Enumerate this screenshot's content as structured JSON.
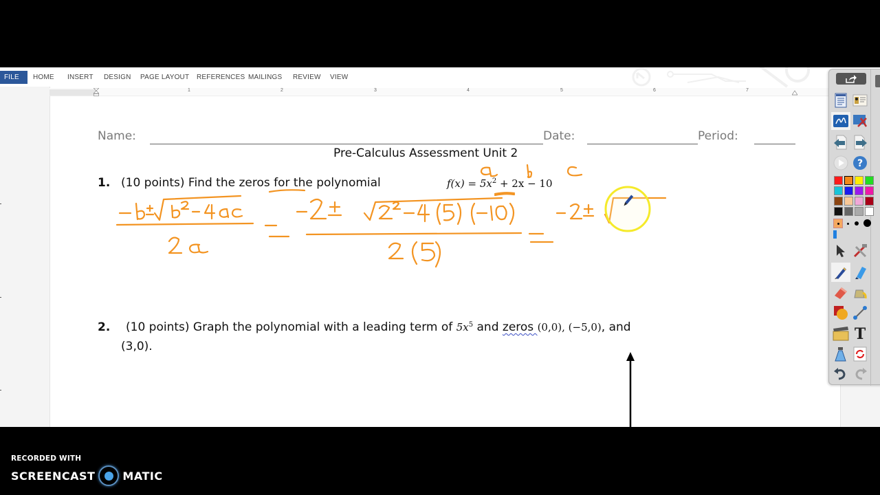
{
  "ribbon": {
    "tabs": [
      "FILE",
      "HOME",
      "INSERT",
      "DESIGN",
      "PAGE LAYOUT",
      "REFERENCES",
      "MAILINGS",
      "REVIEW",
      "VIEW"
    ],
    "colors": {
      "file_tab_bg": "#2b579a",
      "file_tab_text": "#ffffff",
      "tab_text": "#444444"
    }
  },
  "ruler": {
    "numbers": [
      "1",
      "2",
      "3",
      "4",
      "5",
      "6",
      "7"
    ]
  },
  "document": {
    "header": {
      "name_label": "Name:",
      "date_label": "Date:",
      "period_label": "Period:"
    },
    "title": "Pre-Calculus Assessment Unit 2",
    "questions": [
      {
        "number": "1.",
        "text_before": "(10 points) Find the ",
        "keyword": "zeros",
        "text_after": " for the polynomial ",
        "math": "f(x) = 5x² + 2x − 10",
        "math_parts": {
          "lhs": "f(x) = 5x",
          "exp": "2",
          "rhs": " + 2x − 10"
        }
      },
      {
        "number": "2.",
        "text_before": "(10 points) Graph the polynomial with a leading term of ",
        "math_term": {
          "base": "5x",
          "exp": "5"
        },
        "text_mid": " and ",
        "keyword": "zeros ",
        "zeros_list": "(0,0), (−5,0)",
        "text_after": ", and",
        "line2": "(3,0)."
      }
    ]
  },
  "ink": {
    "color": "#f39422",
    "annotations": {
      "labels_above_coefficients": [
        "a",
        "b",
        "c"
      ],
      "quadratic_formula": {
        "numerator": "−b ± √(b² − 4ac)",
        "denominator": "2a"
      },
      "substitution": {
        "numerator": "−2 ± √(2² − 4(5)(−10))",
        "denominator": "2(5)"
      },
      "partial_step": "−2 ± √"
    },
    "cursor_highlight_color": "#f5ea2a"
  },
  "toolbar": {
    "buttons": [
      "share",
      "document-list",
      "id-card",
      "annotate-mode",
      "tools-settings",
      "previous-page",
      "next-page",
      "play",
      "help",
      "select",
      "tools",
      "pen",
      "highlighter",
      "eraser",
      "fill",
      "shapes",
      "line",
      "screen-capture",
      "text",
      "clear",
      "reset",
      "undo",
      "redo"
    ],
    "palette": [
      "#ff1a1a",
      "#f48a1a",
      "#ffee00",
      "#22dd22",
      "#18c4d8",
      "#1a1aee",
      "#9a1aee",
      "#ee1aa8",
      "#8b4513",
      "#f8c898",
      "#f0a8d8",
      "#a80018",
      "#111111",
      "#666666",
      "#aaaaaa",
      "#ffffff"
    ],
    "selected_color": "#f48a1a"
  },
  "recorder": {
    "line1": "RECORDED WITH",
    "brand_left": "SCREENCAST",
    "brand_right": "MATIC"
  }
}
